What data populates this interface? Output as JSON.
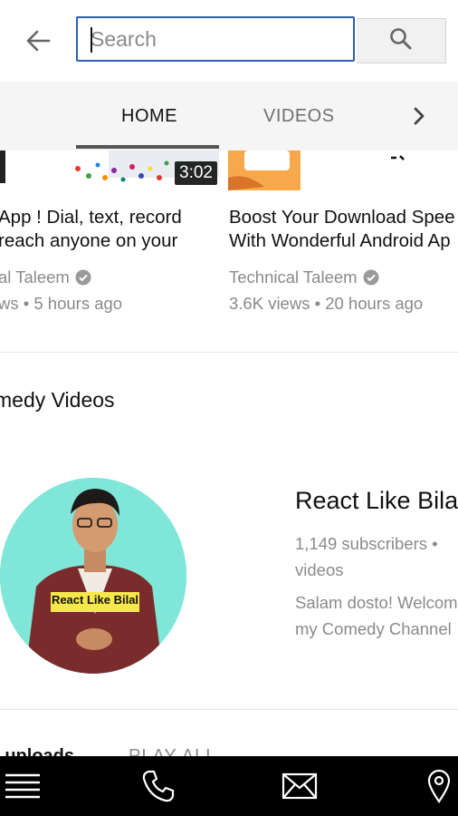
{
  "search": {
    "placeholder": "Search",
    "value": ""
  },
  "tabs": [
    {
      "label": "HOME",
      "selected": true
    },
    {
      "label": "VIDEOS",
      "selected": false
    }
  ],
  "videos": [
    {
      "duration": "3:02",
      "title_line1": "App ! Dial, text, record",
      "title_line2": "reach anyone on your",
      "channel": "al Taleem",
      "stats": "ws • 5 hours ago"
    },
    {
      "title_line1": "Boost Your Download Spee",
      "title_line2": "With Wonderful Android Ap",
      "channel": "Technical Taleem",
      "stats": "3.6K views • 20 hours ago"
    }
  ],
  "section": {
    "title": "medy Videos"
  },
  "channel": {
    "name": "React Like Bilal",
    "avatar_caption": "React Like Bilal",
    "subscribers": "1,149 subscribers •",
    "videos": "videos",
    "desc_line1": "Salam dosto! Welcom",
    "desc_line2": "my Comedy Channel"
  },
  "uploads": {
    "title": "r uploads",
    "play_all": "PLAY ALL"
  },
  "colors": {
    "accent": "#2f5fb3",
    "avatar_bg": "#7fe6d8",
    "nav_bg": "#000000"
  },
  "icons": [
    "back-arrow-icon",
    "search-icon",
    "chevron-right-icon",
    "verified-icon",
    "menu-icon",
    "phone-icon",
    "mail-icon",
    "location-icon"
  ]
}
